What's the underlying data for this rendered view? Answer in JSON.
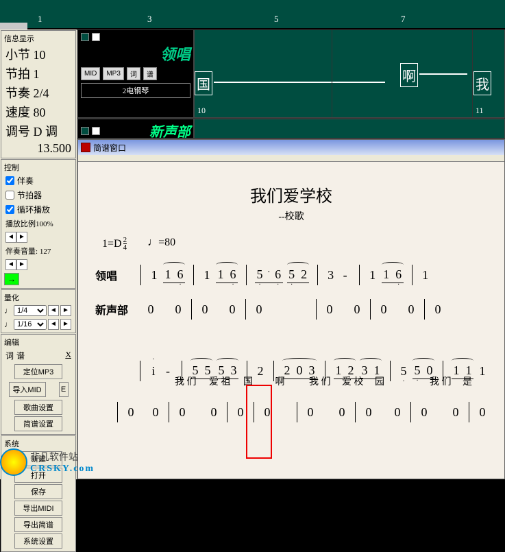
{
  "ruler": {
    "ticks": [
      "1",
      "3",
      "5",
      "7"
    ]
  },
  "info_panel": {
    "title": "信息显示",
    "rows": {
      "measure_label": "小节",
      "measure_val": "10",
      "beat_label": "节拍",
      "beat_val": "1",
      "rhythm_label": "节奏",
      "rhythm_val": "2/4",
      "tempo_label": "速度",
      "tempo_val": "80",
      "key_label": "调号",
      "key_val": "D 调",
      "time_val": "13.500"
    }
  },
  "control_panel": {
    "title": "控制",
    "accompaniment": "伴奏",
    "metronome": "节拍器",
    "loop": "循环播放",
    "play_ratio": "播放比例100%",
    "accomp_vol_label": "伴奏音量:",
    "accomp_vol_val": "127"
  },
  "quantize_panel": {
    "title": "量化",
    "opt1": "1/4",
    "opt2": "1/16"
  },
  "edit_panel": {
    "title": "编辑",
    "word": "词",
    "score": "谱",
    "close": "X",
    "buttons": [
      "定位MP3",
      "导入MID",
      "歌曲设置",
      "简谱设置"
    ],
    "btn_e": "E"
  },
  "system_panel": {
    "title": "系统",
    "buttons": [
      "新建",
      "打开",
      "保存",
      "导出MIDI",
      "导出简谱",
      "系统设置"
    ]
  },
  "tracks": {
    "track1": {
      "title": "领唱",
      "btns": [
        "MID",
        "MP3",
        "词",
        "谱"
      ],
      "instrument": "2电钢琴",
      "note1": "国",
      "note2": "啊",
      "note3": "我",
      "m1": "10",
      "m2": "11"
    },
    "track2": {
      "title": "新声部"
    }
  },
  "score": {
    "window_title": "简谱窗口",
    "title": "我们爱学校",
    "subtitle": "--校歌",
    "key": "1=D",
    "time_top": "2",
    "time_bot": "4",
    "tempo": "♩=80",
    "part1": "领唱",
    "part2": "新声部",
    "line1_notes": [
      "1",
      "1",
      "6",
      "1",
      "1",
      "6",
      "5",
      "6",
      "5",
      "2",
      "3",
      "-",
      "1",
      "1",
      "6",
      "1"
    ],
    "line1_zeros": [
      "0",
      "0",
      "0",
      "0",
      "0",
      "0",
      "0",
      "0",
      "0",
      "0"
    ],
    "line2_top": [
      "i",
      "-",
      "5",
      "5",
      "5",
      "3",
      "2",
      "2",
      "0",
      "3",
      "1",
      "2",
      "3",
      "1",
      "5",
      "5",
      "0",
      "1",
      "1",
      "1"
    ],
    "line2_lyrics": [
      "我",
      "们",
      "爱",
      "祖",
      "国",
      "啊",
      "我",
      "们",
      "爱",
      "校",
      "园",
      "我",
      "们",
      "是"
    ],
    "line2_bot": [
      "0",
      "0",
      "0",
      "0",
      "0",
      "0",
      "0",
      "0",
      "0",
      "0",
      "0",
      "0",
      "0"
    ]
  },
  "watermark": {
    "text": "非凡软件站",
    "domain": "CRSKY.com"
  }
}
